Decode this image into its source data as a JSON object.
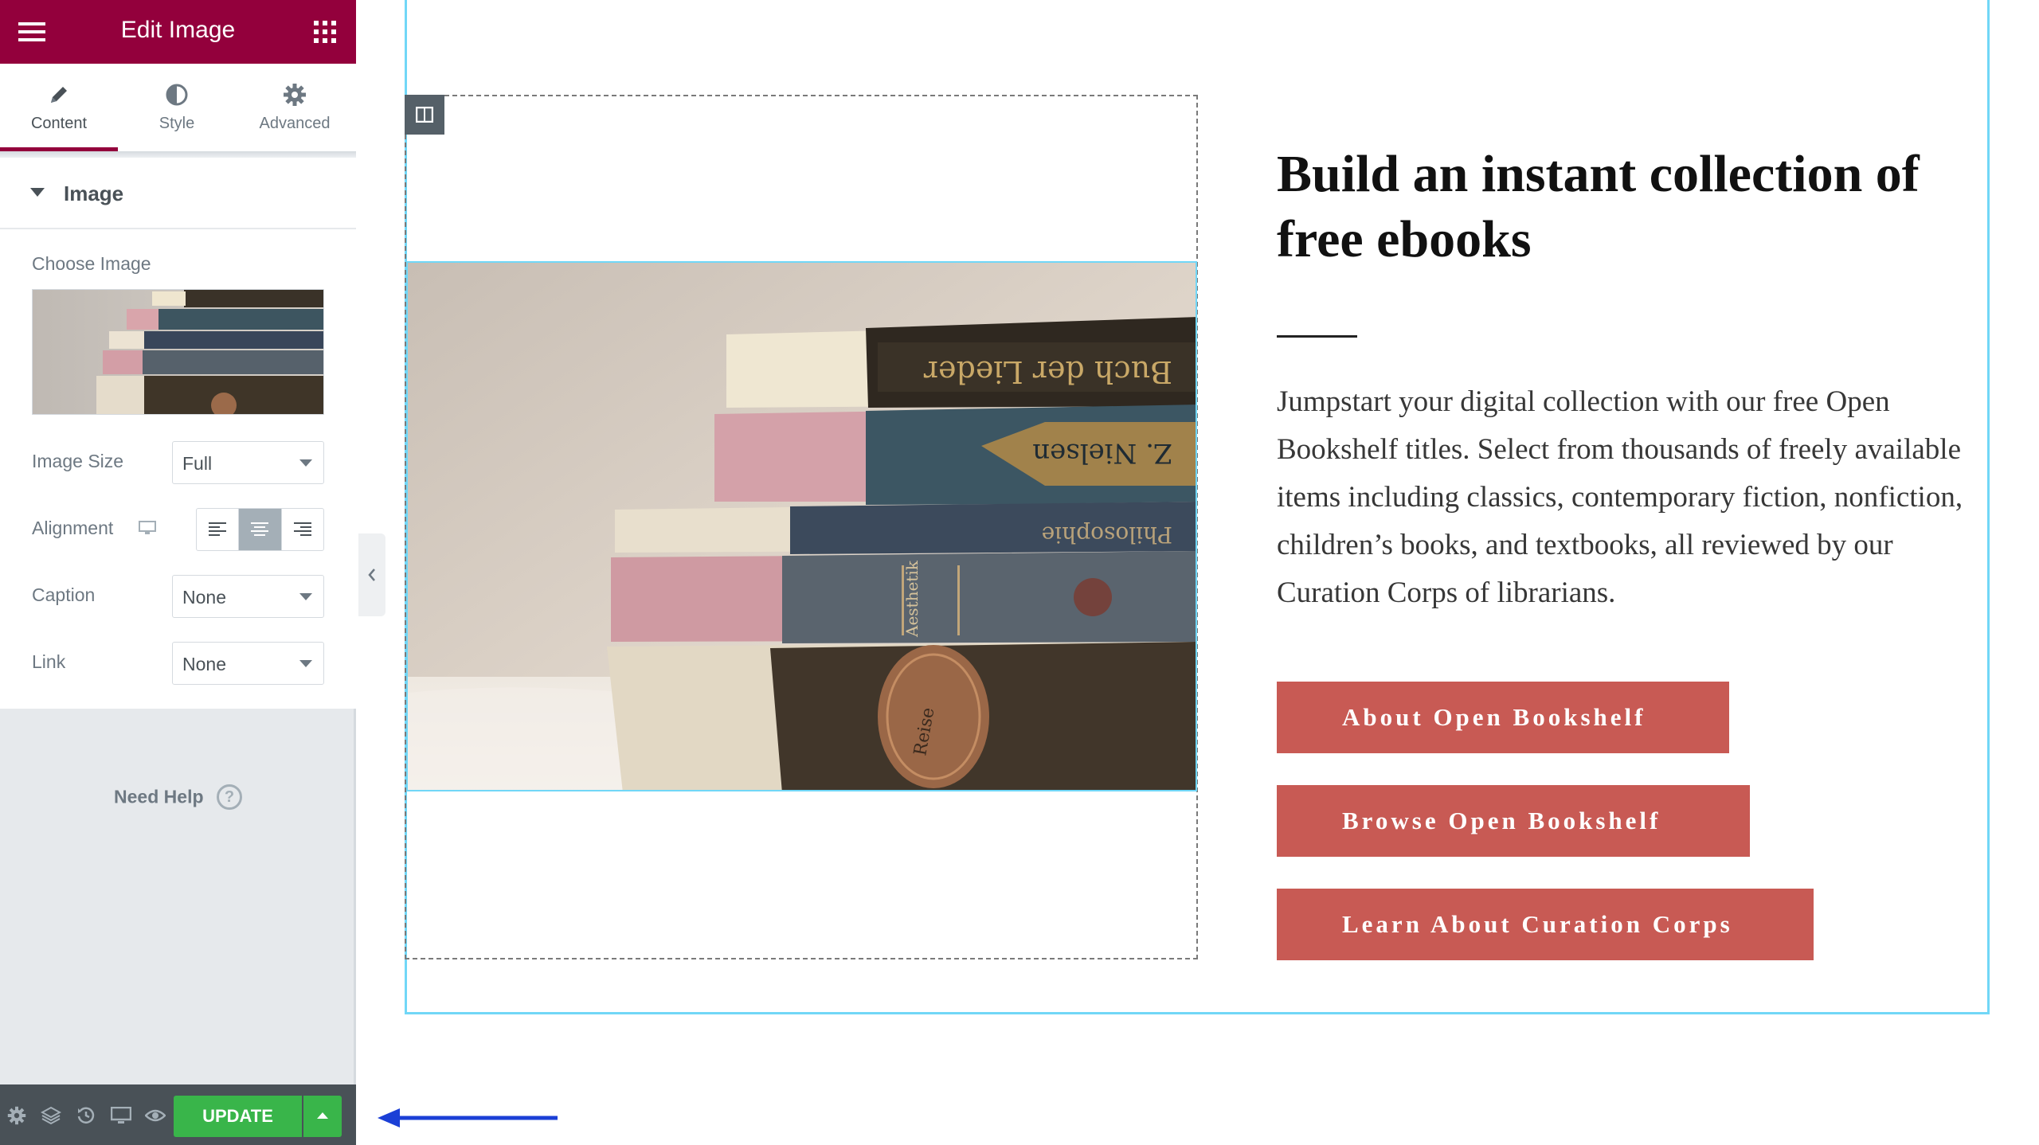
{
  "panel": {
    "title": "Edit Image",
    "menu_icon": "hamburger-icon",
    "grid_icon": "apps-grid-icon",
    "accent_color": "#93003c",
    "tabs": [
      {
        "label": "Content",
        "icon": "pencil-icon",
        "active": true
      },
      {
        "label": "Style",
        "icon": "contrast-icon",
        "active": false
      },
      {
        "label": "Advanced",
        "icon": "gear-icon",
        "active": false
      }
    ],
    "section_title": "Image",
    "choose_image_label": "Choose Image",
    "image_size_label": "Image Size",
    "image_size_value": "Full",
    "alignment_label": "Alignment",
    "alignment_selected": "center",
    "caption_label": "Caption",
    "caption_value": "None",
    "link_label": "Link",
    "link_value": "None",
    "help_text": "Need Help",
    "help_icon": "?"
  },
  "footer": {
    "icons": [
      "settings-icon",
      "layers-icon",
      "history-icon",
      "responsive-icon",
      "preview-eye-icon"
    ],
    "update_label": "UPDATE",
    "update_color": "#39b54a"
  },
  "canvas": {
    "heading": "Build an instant collection of free ebooks",
    "body": "Jumpstart your digital collection with our free Open Bookshelf titles. Select from thousands of freely available items including classics, contemporary fiction, nonfiction, children’s books, and textbooks, all reviewed by our Curation Corps of librarians.",
    "buttons": [
      {
        "label": "About Open Bookshelf"
      },
      {
        "label": "Browse Open Bookshelf"
      },
      {
        "label": "Learn About Curation Corps"
      }
    ],
    "button_color": "#c85a54",
    "selection_color": "#71d7f7",
    "book_spine_texts": [
      "Buch der Lieder",
      "Z. Nielsen",
      "Philosophie",
      "Aesthetik",
      "Reise"
    ]
  },
  "annotation": {
    "arrow_color": "#1b3fd6"
  }
}
